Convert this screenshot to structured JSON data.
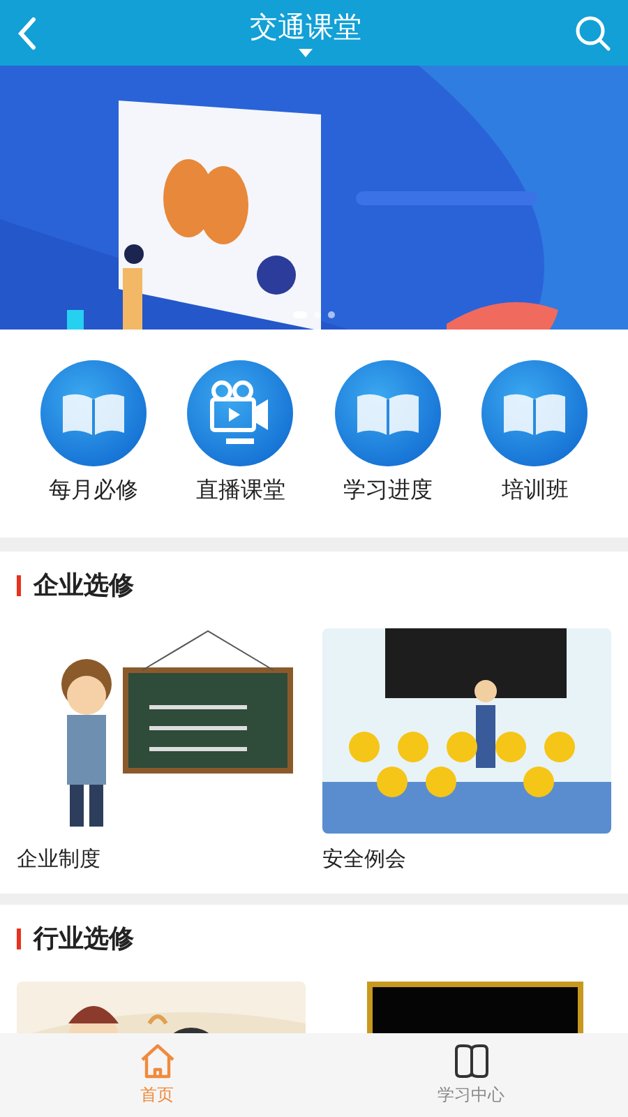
{
  "header": {
    "title": "交通课堂"
  },
  "banner": {
    "kind": "picture",
    "dots": [
      {
        "selected": true
      },
      {
        "selected": false
      },
      {
        "selected": false
      }
    ]
  },
  "shortcuts": [
    {
      "label": "每月必修",
      "kind": "book"
    },
    {
      "label": "直播课堂",
      "kind": "camera"
    },
    {
      "label": "学习进度",
      "kind": "book"
    },
    {
      "label": "培训班",
      "kind": "book"
    }
  ],
  "sections": [
    {
      "title": "企业选修",
      "items": [
        {
          "kind": "picture",
          "caption": "企业制度"
        },
        {
          "kind": "picture",
          "caption": "安全例会"
        }
      ]
    },
    {
      "title": "行业选修"
    }
  ],
  "tabbar": [
    {
      "label": "首页",
      "kind": "home",
      "selected": true
    },
    {
      "label": "学习中心",
      "kind": "book",
      "selected": false
    }
  ]
}
